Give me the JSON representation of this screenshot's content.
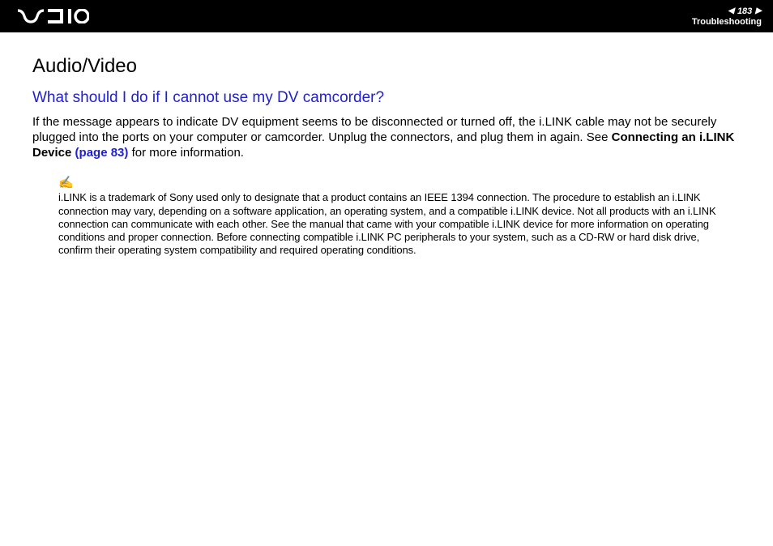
{
  "header": {
    "page_number": "183",
    "section": "Troubleshooting"
  },
  "content": {
    "heading1": "Audio/Video",
    "heading2": "What should I do if I cannot use my DV camcorder?",
    "body_part1": "If the message appears to indicate DV equipment seems to be disconnected or turned off, the i.LINK cable may not be securely plugged into the ports on your computer or camcorder. Unplug the connectors, and plug them in again. See ",
    "body_bold": "Connecting an i.LINK Device ",
    "body_link": "(page 83)",
    "body_part2": " for more information.",
    "note_icon": "✍",
    "note_text": "i.LINK is a trademark of Sony used only to designate that a product contains an IEEE 1394 connection. The procedure to establish an i.LINK connection may vary, depending on a software application, an operating system, and a compatible i.LINK device. Not all products with an i.LINK connection can communicate with each other. See the manual that came with your compatible i.LINK device for more information on operating conditions and proper connection. Before connecting compatible i.LINK PC peripherals to your system, such as a CD-RW or hard disk drive, confirm their operating system compatibility and required operating conditions."
  }
}
